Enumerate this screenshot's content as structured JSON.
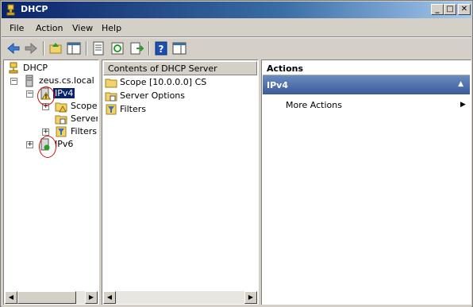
{
  "window": {
    "title": "DHCP"
  },
  "menu": {
    "items": [
      "File",
      "Action",
      "View",
      "Help"
    ]
  },
  "toolbar": {
    "icons": [
      "back-icon",
      "forward-icon",
      "up-folder-icon",
      "show-hide-tree-icon",
      "properties-icon",
      "refresh-icon",
      "export-icon",
      "help-icon",
      "show-hide-action-icon"
    ]
  },
  "tree": {
    "root": "DHCP",
    "server": "zeus.cs.local",
    "ipv4": "IPv4",
    "scope": "Scope [",
    "server_options": "Server",
    "filters": "Filters",
    "ipv6": "IPv6"
  },
  "content": {
    "header": "Contents of DHCP Server",
    "items": [
      "Scope [10.0.0.0] CS",
      "Server Options",
      "Filters"
    ]
  },
  "actions": {
    "title": "Actions",
    "section": "IPv4",
    "items": [
      {
        "label": "More Actions"
      }
    ]
  }
}
